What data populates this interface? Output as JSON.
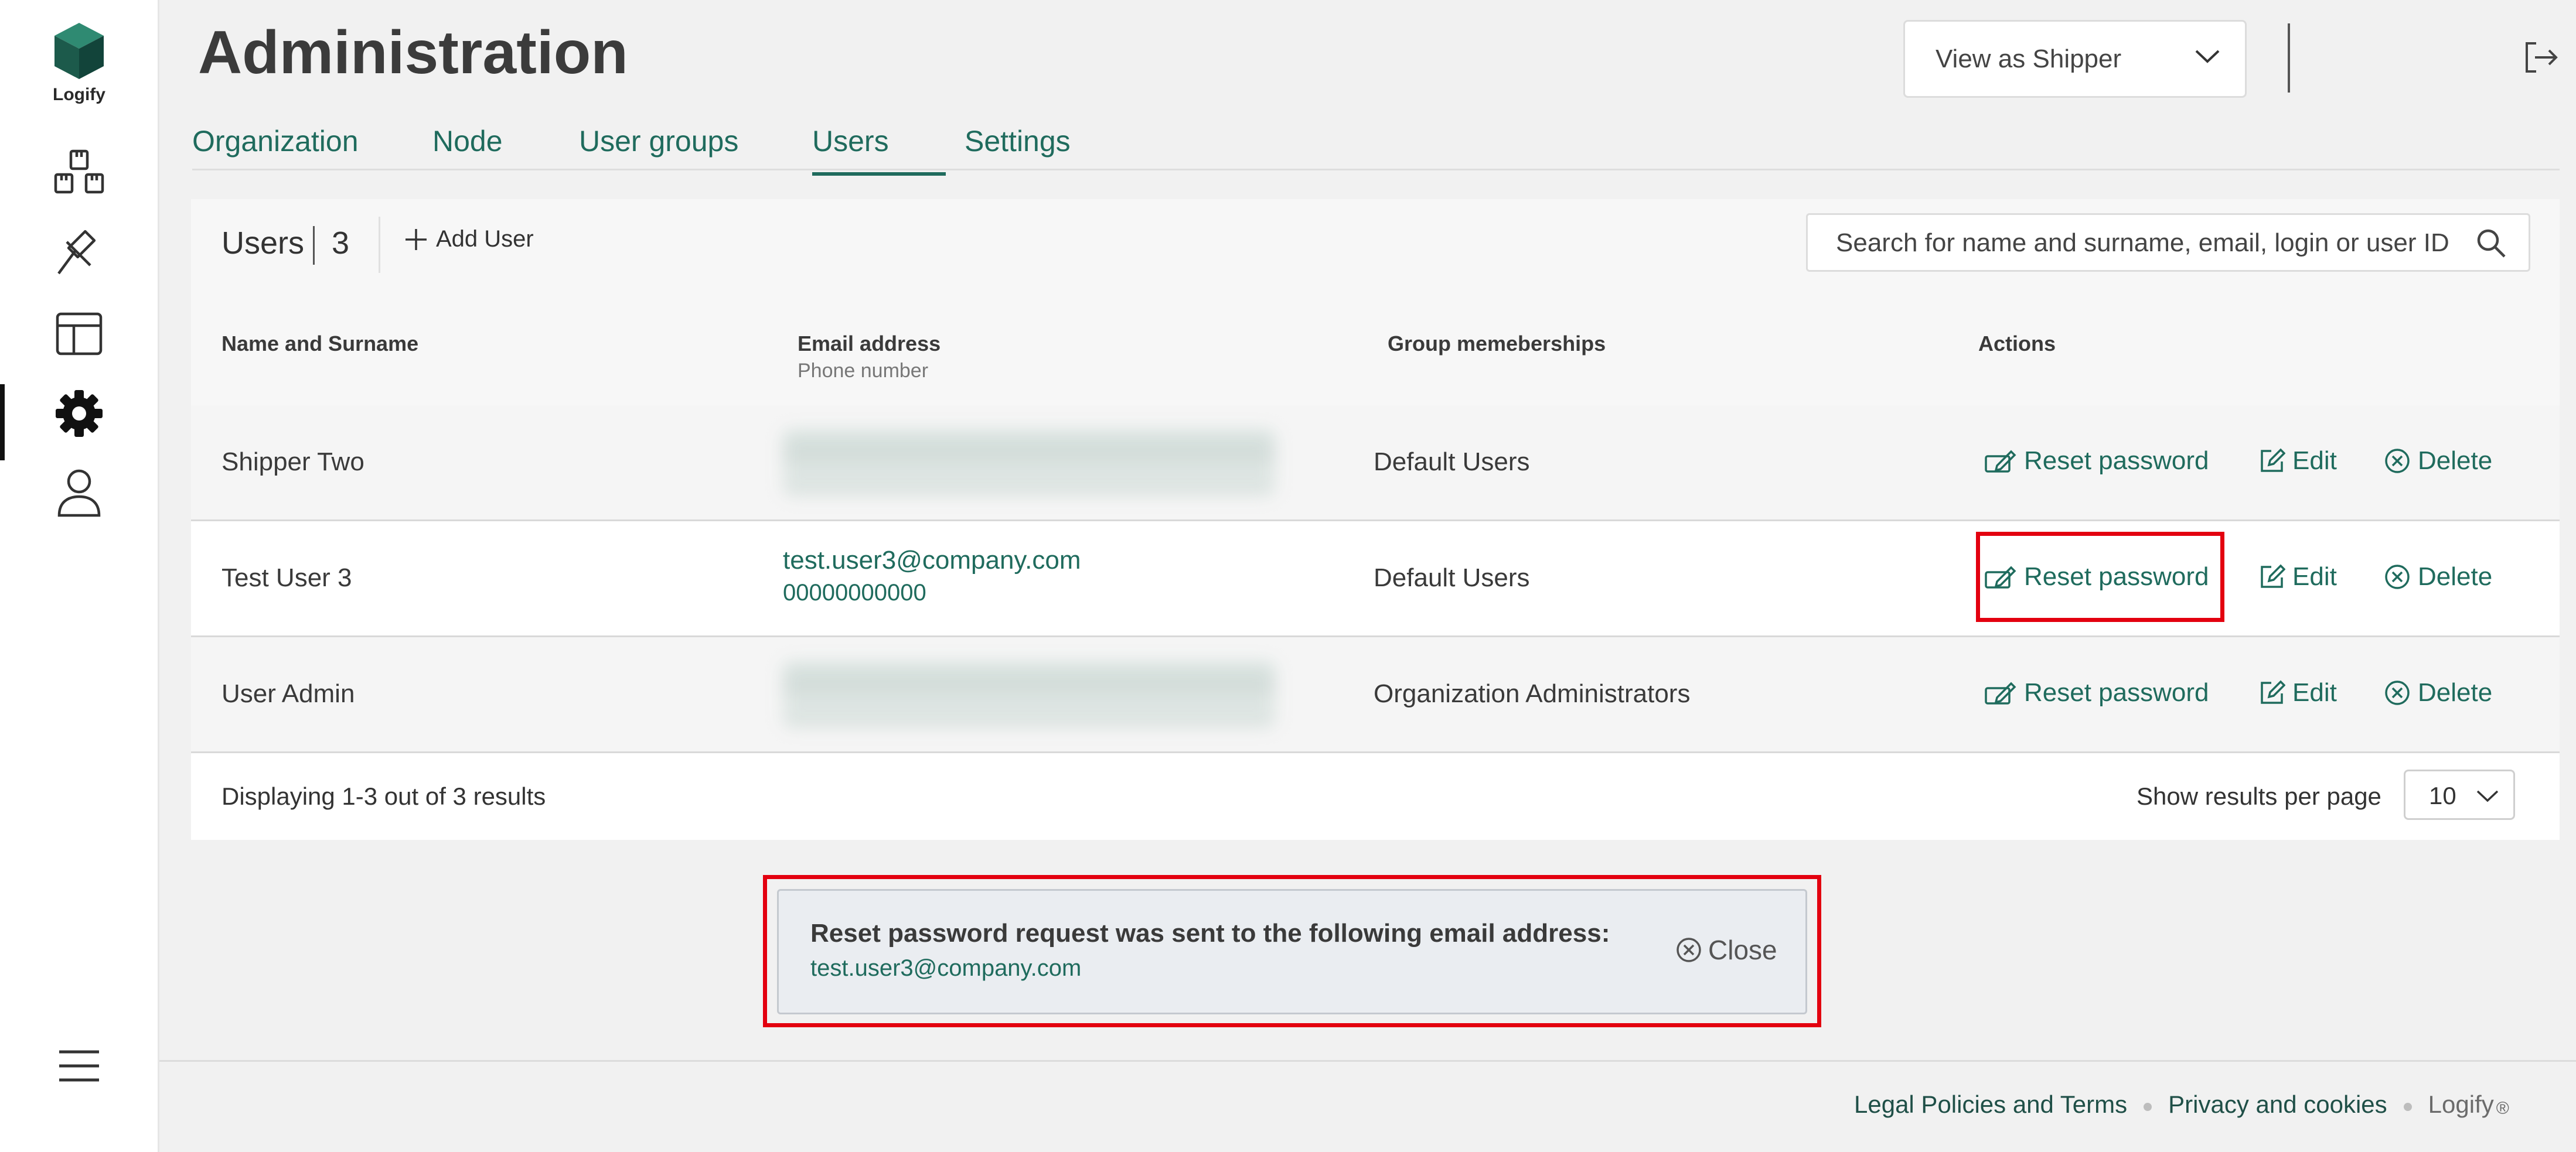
{
  "app": {
    "logo_text": "Logify"
  },
  "sidebar": {
    "items": [
      {
        "icon": "boxes-icon"
      },
      {
        "icon": "gavel-icon"
      },
      {
        "icon": "layout-icon"
      },
      {
        "icon": "gear-icon",
        "active": true
      },
      {
        "icon": "user-icon"
      },
      {
        "icon": "menu-icon"
      }
    ]
  },
  "header": {
    "title": "Administration",
    "view_select": "View as Shipper"
  },
  "tabs": [
    {
      "label": "Organization"
    },
    {
      "label": "Node"
    },
    {
      "label": "User groups"
    },
    {
      "label": "Users",
      "active": true
    },
    {
      "label": "Settings"
    }
  ],
  "users": {
    "title": "Users",
    "count": "3",
    "add_label": "Add User",
    "search_placeholder": "Search for name and surname, email, login or user ID",
    "columns": {
      "name": "Name and Surname",
      "email": "Email address",
      "phone": "Phone number",
      "groups": "Group memeberships",
      "actions": "Actions"
    },
    "action_labels": {
      "reset": "Reset password",
      "edit": "Edit",
      "delete": "Delete"
    },
    "rows": [
      {
        "name": "Shipper Two",
        "email_hidden": true,
        "group": "Default Users"
      },
      {
        "name": "Test User 3",
        "email": "test.user3@company.com",
        "phone": "00000000000",
        "group": "Default Users"
      },
      {
        "name": "User Admin",
        "email_hidden": true,
        "group": "Organization Administrators"
      }
    ],
    "pagination": {
      "summary": "Displaying 1-3 out of 3 results",
      "per_page_label": "Show results per page",
      "per_page_value": "10"
    }
  },
  "notification": {
    "message": "Reset password request was sent to the following email address:",
    "email": "test.user3@company.com",
    "close_label": "Close"
  },
  "footer": {
    "legal": "Legal Policies and Terms",
    "privacy": "Privacy and cookies",
    "brand": "Logify",
    "reg": "®"
  },
  "colors": {
    "accent": "#1f6b5d",
    "highlight": "#e3000f",
    "notice_bg": "#eaedf1"
  }
}
